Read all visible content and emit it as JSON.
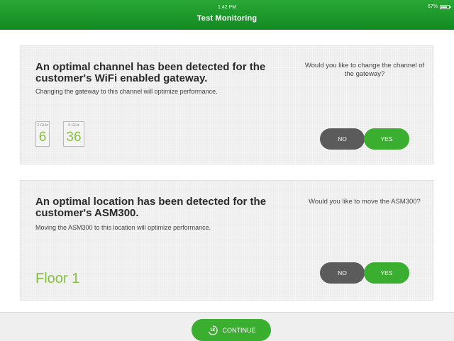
{
  "status_bar": {
    "time": "1:42 PM",
    "battery": "67%"
  },
  "header": {
    "title": "Test Monitoring"
  },
  "cards": [
    {
      "title": "An optimal channel has been detected for the customer's WiFi enabled gateway.",
      "subtitle": "Changing the gateway to this channel will optimize performance.",
      "question": "Would you like to change the channel of the gateway?",
      "channels": [
        {
          "band": "2 GHz",
          "value": "6"
        },
        {
          "band": "5 GHz",
          "value": "36"
        }
      ],
      "no_label": "NO",
      "yes_label": "YES"
    },
    {
      "title": "An optimal location has been detected for the customer's ASM300.",
      "subtitle": "Moving the ASM300 to this location will optimize performance.",
      "question": "Would you like to move the ASM300?",
      "location": "Floor 1",
      "no_label": "NO",
      "yes_label": "YES"
    }
  ],
  "footer": {
    "timer_value": "18",
    "continue_label": "CONTINUE"
  },
  "colors": {
    "header_green": "#1e9a2c",
    "accent_green": "#86c23f",
    "yes_button": "#3aae2e",
    "no_button": "#5b5b5b"
  }
}
